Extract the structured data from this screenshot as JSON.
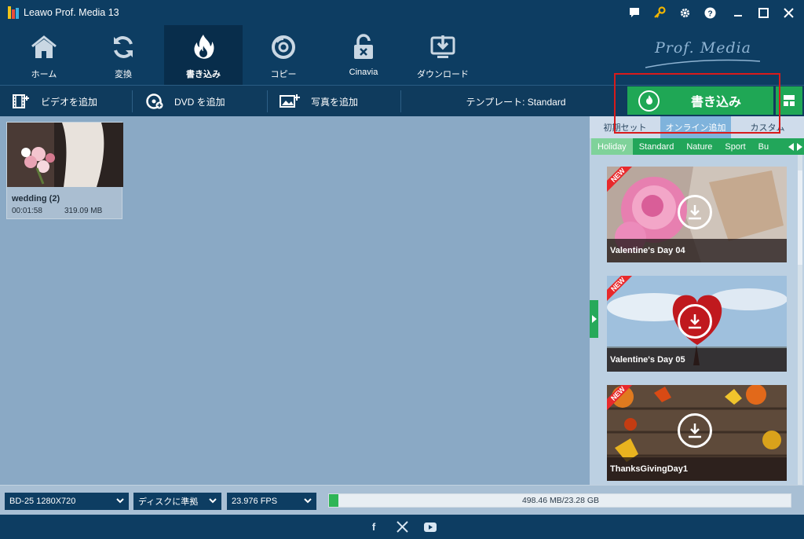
{
  "app": {
    "title": "Leawo Prof. Media 13",
    "brand": "Prof. Media"
  },
  "titlebar_icons": [
    "chat-icon",
    "key-icon",
    "gear-icon",
    "help-icon",
    "minimize-icon",
    "maximize-icon",
    "close-icon"
  ],
  "nav": {
    "items": [
      {
        "label": "ホーム",
        "icon": "home-icon"
      },
      {
        "label": "変換",
        "icon": "convert-icon"
      },
      {
        "label": "書き込み",
        "icon": "burn-icon",
        "active": true
      },
      {
        "label": "コピー",
        "icon": "copy-icon"
      },
      {
        "label": "Cinavia",
        "icon": "cinavia-icon"
      },
      {
        "label": "ダウンロード",
        "icon": "download-icon"
      }
    ]
  },
  "toolbar": {
    "add_video": "ビデオを追加",
    "add_dvd": "DVD を追加",
    "add_photo": "写真を追加",
    "template": "テンプレート: Standard",
    "burn": "書き込み"
  },
  "video": {
    "title": "wedding (2)",
    "duration": "00:01:58",
    "size": "319.09 MB"
  },
  "panel": {
    "tabs": [
      "初期セット",
      "オンライン追加",
      "カスタム"
    ],
    "categories": [
      "Holiday",
      "Standard",
      "Nature",
      "Sport",
      "Bu"
    ],
    "templates": [
      {
        "name": "Valentine's Day 04",
        "badge": "NEW"
      },
      {
        "name": "Valentine's Day 05",
        "badge": "NEW"
      },
      {
        "name": "ThanksGivingDay1",
        "badge": "NEW"
      }
    ]
  },
  "bottom": {
    "disc_type": "BD-25 1280X720",
    "aspect": "ディスクに準拠",
    "fps": "23.976 FPS",
    "capacity_text": "498.46 MB/23.28 GB",
    "capacity_fraction": 0.021
  },
  "social": [
    "facebook-icon",
    "x-icon",
    "youtube-icon"
  ],
  "colors": {
    "accent_green": "#1fa755",
    "header_blue": "#0d3d62",
    "highlight_red": "#d81b1b"
  }
}
